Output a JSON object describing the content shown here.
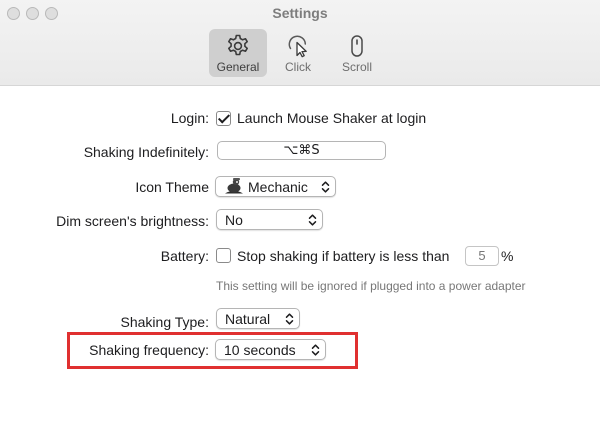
{
  "window": {
    "title": "Settings"
  },
  "tabs": [
    {
      "label": "General",
      "icon": "gear-icon",
      "active": true
    },
    {
      "label": "Click",
      "icon": "cursor-click-icon",
      "active": false
    },
    {
      "label": "Scroll",
      "icon": "mouse-scroll-icon",
      "active": false
    }
  ],
  "form": {
    "login": {
      "label": "Login:",
      "checkbox_label": "Launch Mouse Shaker at login",
      "checked": true
    },
    "shaking_indefinitely": {
      "label": "Shaking Indefinitely:",
      "shortcut": "⌥⌘S"
    },
    "icon_theme": {
      "label": "Icon Theme",
      "value": "Mechanic",
      "icon": "mechanic-icon"
    },
    "dim_screen": {
      "label": "Dim screen's brightness:",
      "value": "No"
    },
    "battery": {
      "label": "Battery:",
      "checkbox_label": "Stop shaking if battery is less than",
      "checked": false,
      "threshold_placeholder": "5",
      "unit": "%",
      "note": "This setting will be ignored if plugged into a power adapter"
    },
    "shaking_type": {
      "label": "Shaking Type:",
      "value": "Natural"
    },
    "shaking_frequency": {
      "label": "Shaking frequency:",
      "value": "10 seconds"
    }
  },
  "colors": {
    "highlight": "#e03030",
    "active_tab": "#cfcfcf"
  }
}
